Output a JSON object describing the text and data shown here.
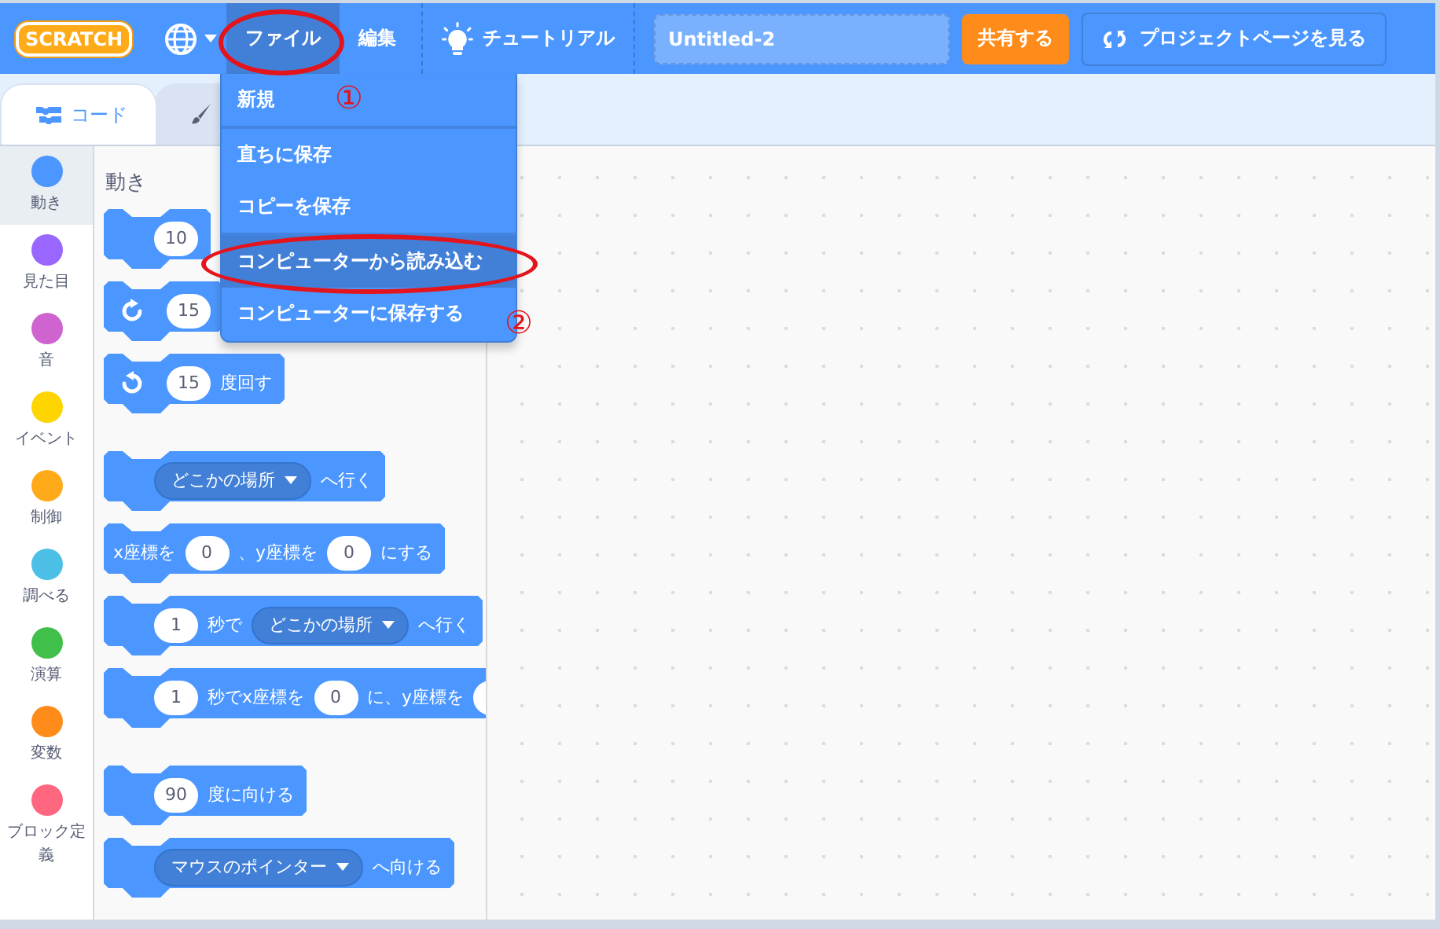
{
  "menubar": {
    "logo": "SCRATCH",
    "items": [
      {
        "kind": "language"
      },
      {
        "kind": "menu",
        "label": "ファイル",
        "selected": true
      },
      {
        "kind": "menu",
        "label": "編集",
        "selected": false
      },
      {
        "kind": "tutorial",
        "label": "チュートリアル"
      }
    ],
    "title_field": {
      "value": "Untitled-2"
    },
    "share_button": "共有する",
    "project_page_button": "プロジェクトページを見る"
  },
  "tabs": [
    {
      "kind": "code",
      "label": "コード",
      "selected": true
    },
    {
      "kind": "costume",
      "selected": false
    }
  ],
  "categories": [
    {
      "name": "動き",
      "color": "#4c97ff",
      "selected": true
    },
    {
      "name": "見た目",
      "color": "#9966ff",
      "selected": false
    },
    {
      "name": "音",
      "color": "#cf63cf",
      "selected": false
    },
    {
      "name": "イベント",
      "color": "#ffd500",
      "selected": false
    },
    {
      "name": "制御",
      "color": "#ffab19",
      "selected": false
    },
    {
      "name": "調べる",
      "color": "#4cbfe6",
      "selected": false
    },
    {
      "name": "演算",
      "color": "#40bf4a",
      "selected": false
    },
    {
      "name": "変数",
      "color": "#ff8c1a",
      "selected": false
    },
    {
      "name": "ブロック定義",
      "color": "#ff6680",
      "selected": false
    }
  ],
  "palette": {
    "heading": "動き",
    "groups": [
      [
        [
          {
            "kind": "number",
            "text": "10"
          }
        ],
        [
          {
            "kind": "turn_right"
          },
          {
            "kind": "number",
            "text": "15"
          }
        ],
        [
          {
            "kind": "turn_left"
          },
          {
            "kind": "number",
            "text": "15"
          },
          {
            "kind": "text",
            "text": "度回す"
          }
        ]
      ],
      [
        [
          {
            "kind": "dropdown",
            "text": "どこかの場所"
          },
          {
            "kind": "text",
            "text": "へ行く"
          }
        ],
        [
          {
            "kind": "text",
            "text": "x座標を"
          },
          {
            "kind": "number",
            "text": "0"
          },
          {
            "kind": "text",
            "text": "、y座標を"
          },
          {
            "kind": "number",
            "text": "0"
          },
          {
            "kind": "text",
            "text": "にする"
          }
        ],
        [
          {
            "kind": "number",
            "text": "1"
          },
          {
            "kind": "text",
            "text": "秒で"
          },
          {
            "kind": "dropdown",
            "text": "どこかの場所"
          },
          {
            "kind": "text",
            "text": "へ行く"
          }
        ],
        [
          {
            "kind": "number",
            "text": "1"
          },
          {
            "kind": "text",
            "text": "秒でx座標を"
          },
          {
            "kind": "number",
            "text": "0"
          },
          {
            "kind": "text",
            "text": "に、y座標を"
          },
          {
            "kind": "number"
          }
        ]
      ],
      [
        [
          {
            "kind": "number",
            "text": "90"
          },
          {
            "kind": "text",
            "text": "度に向ける"
          }
        ],
        [
          {
            "kind": "dropdown",
            "text": "マウスのポインター"
          },
          {
            "kind": "text",
            "text": "へ向ける"
          }
        ]
      ]
    ]
  },
  "file_menu": [
    {
      "label": "新規",
      "selected": false,
      "divider_after": true
    },
    {
      "label": "直ちに保存",
      "selected": false,
      "divider_after": false
    },
    {
      "label": "コピーを保存",
      "selected": false,
      "divider_after": true
    },
    {
      "label": "コンピューターから読み込む",
      "selected": true,
      "divider_after": false
    },
    {
      "label": "コンピューターに保存する",
      "selected": false,
      "divider_after": false
    }
  ],
  "annotations": [
    {
      "kind": "ellipse"
    },
    {
      "kind": "mark",
      "text": "①"
    },
    {
      "kind": "ellipse"
    },
    {
      "kind": "mark",
      "text": "②"
    }
  ]
}
